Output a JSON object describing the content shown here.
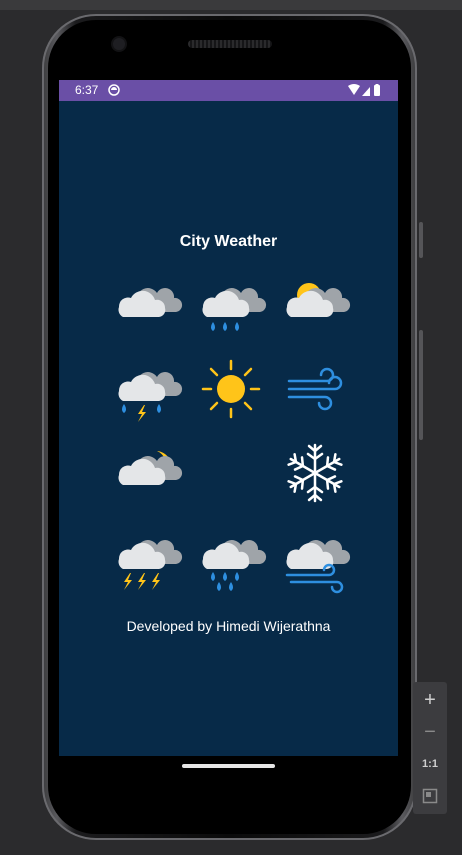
{
  "status_bar": {
    "time": "6:37"
  },
  "app": {
    "title": "City Weather",
    "footer": "Developed by Himedi Wijerathna",
    "background_color": "#072a48",
    "status_bar_color": "#6a4fa6",
    "accent_sun": "#ffc419",
    "accent_rain": "#2e8fe0"
  },
  "icons": [
    {
      "name": "cloudy-icon"
    },
    {
      "name": "rain-cloud-icon"
    },
    {
      "name": "partly-sunny-icon"
    },
    {
      "name": "thunderstorm-rain-icon"
    },
    {
      "name": "sun-icon"
    },
    {
      "name": "wind-icon"
    },
    {
      "name": "cloudy-night-icon"
    },
    {
      "name": "crescent-moon-icon"
    },
    {
      "name": "snowflake-icon"
    },
    {
      "name": "heavy-thunderstorm-icon"
    },
    {
      "name": "heavy-rain-icon"
    },
    {
      "name": "windy-cloud-icon"
    }
  ],
  "emulator_toolbar": {
    "zoom_in": "+",
    "zoom_out": "−",
    "actual_size": "1:1"
  }
}
